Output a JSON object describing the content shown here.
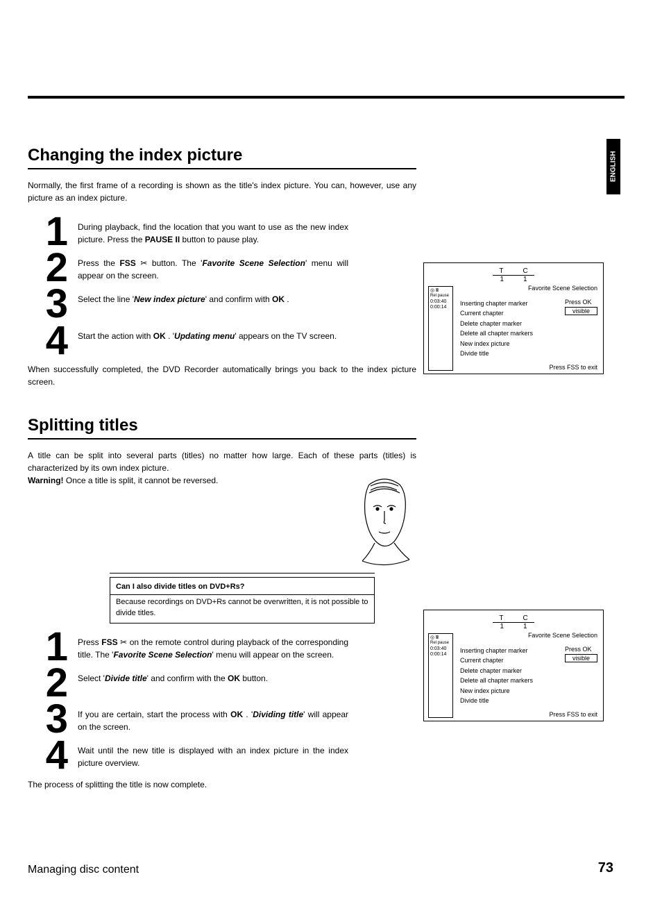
{
  "lang_tab": "ENGLISH",
  "footer": {
    "left": "Managing disc content",
    "page": "73"
  },
  "section1": {
    "title": "Changing the index picture",
    "intro": "Normally, the first frame of a recording is shown as the title's index picture. You can, however, use any picture as an index picture.",
    "steps": {
      "s1": {
        "num": "1",
        "a": "During playback, find the location that you want to use as the new index picture. Press the ",
        "b": "PAUSE",
        "c": " button to pause play."
      },
      "s2": {
        "num": "2",
        "a": "Press the ",
        "b": "FSS",
        "c": " button. The '",
        "d": "Favorite Scene Selection",
        "e": "' menu will appear on the screen."
      },
      "s3": {
        "num": "3",
        "a": "Select the line '",
        "b": "New index picture",
        "c": "' and confirm with ",
        "d": "OK",
        "e": " ."
      },
      "s4": {
        "num": "4",
        "a": "Start the action with ",
        "b": "OK",
        "c": " . '",
        "d": "Updating menu",
        "e": "' appears on the TV screen."
      }
    },
    "after": "When successfully completed, the DVD Recorder automatically brings you back to the index picture screen."
  },
  "section2": {
    "title": "Splitting titles",
    "intro_a": "A title can be split into several parts (titles) no matter how large. Each of these parts (titles) is characterized by its own index picture.",
    "warn_label": "Warning!",
    "intro_b": " Once a title is split, it cannot be reversed.",
    "note": {
      "q": "Can I also divide titles on DVD+Rs?",
      "a": "Because recordings on DVD+Rs cannot be overwritten, it is not possible to divide titles."
    },
    "qmark": "?",
    "steps": {
      "s1": {
        "num": "1",
        "a": "Press ",
        "b": "FSS",
        "c": " on the remote control during playback of the corresponding title. The '",
        "d": "Favorite Scene Selection",
        "e": "' menu will appear on the screen."
      },
      "s2": {
        "num": "2",
        "a": "Select '",
        "b": "Divide title",
        "c": "' and confirm with the ",
        "d": "OK",
        "e": " button."
      },
      "s3": {
        "num": "3",
        "a": "If you are certain, start the process with ",
        "b": "OK",
        "c": " . '",
        "d": "Dividing title",
        "e": "' will appear on the screen."
      },
      "s4": {
        "num": "4",
        "a": "Wait until the new title is displayed with an index picture in the index picture overview."
      }
    },
    "after": "The process of splitting the title is now complete."
  },
  "panel": {
    "top": {
      "t": "T",
      "c": "C",
      "tv": "1",
      "cv": "1"
    },
    "left": {
      "l1": "pause",
      "l2": "0:03:40",
      "l3": "0:00:14"
    },
    "title": "Favorite Scene Selection",
    "items": {
      "i1": "Inserting chapter marker",
      "i2": "Current chapter",
      "i3": "Delete chapter marker",
      "i4": "Delete all chapter markers",
      "i5": "New index picture",
      "i6": "Divide title"
    },
    "right": {
      "press_ok": "Press OK",
      "visible": "visible"
    },
    "foot": "Press FSS to exit"
  }
}
